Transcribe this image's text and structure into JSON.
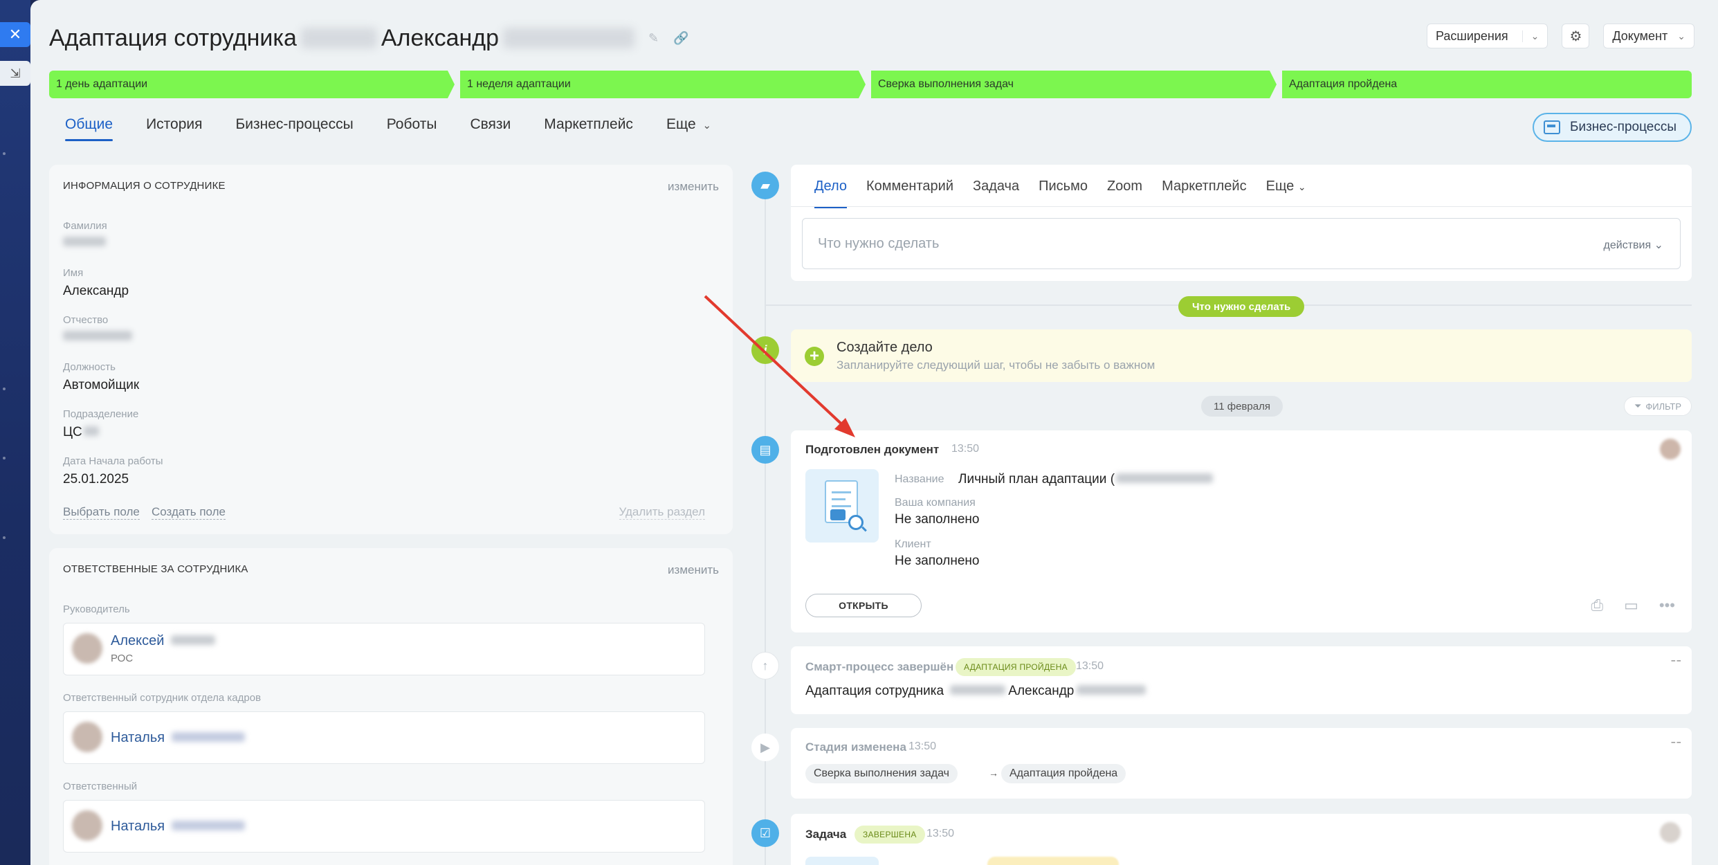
{
  "window": {
    "title_prefix": "Адаптация сотрудника",
    "title_name": "Александр",
    "title_icons": "✎ 🔗"
  },
  "sidebar": {
    "close_icon": "✕",
    "minimize_icon": "⇲"
  },
  "top_actions": {
    "extensions_label": "Расширения",
    "document_label": "Документ",
    "chevron": "⌄",
    "gear": "⚙"
  },
  "stages": [
    {
      "label": "1 день адаптации"
    },
    {
      "label": "1 неделя адаптации"
    },
    {
      "label": "Сверка выполнения задач"
    },
    {
      "label": "Адаптация пройдена"
    }
  ],
  "colors": {
    "stage_green": "#7cf64f",
    "accent_blue": "#1c60c6",
    "timeline_blue": "#4fb0e8",
    "timeline_green": "#9ccd33"
  },
  "tabs": [
    {
      "label": "Общие"
    },
    {
      "label": "История"
    },
    {
      "label": "Бизнес-процессы"
    },
    {
      "label": "Роботы"
    },
    {
      "label": "Связи"
    },
    {
      "label": "Маркетплейс"
    },
    {
      "label": "Еще"
    }
  ],
  "bp_button": {
    "label": "Бизнес-процессы"
  },
  "employee_card": {
    "header": "Информация о сотруднике",
    "edit": "изменить",
    "fields": [
      {
        "label": "Фамилия",
        "value": ""
      },
      {
        "label": "Имя",
        "value": "Александр"
      },
      {
        "label": "Отчество",
        "value": ""
      },
      {
        "label": "Должность",
        "value": "Автомойщик"
      },
      {
        "label": "Подразделение",
        "value": "ЦС"
      },
      {
        "label": "Дата Начала работы",
        "value": "25.01.2025"
      }
    ],
    "select_field": "Выбрать поле",
    "create_field": "Создать поле",
    "delete_section": "Удалить раздел"
  },
  "responsible_card": {
    "header": "Ответственные за сотрудника",
    "edit": "изменить",
    "groups": [
      {
        "label": "Руководитель",
        "name": "Алексей",
        "sub": "РОС"
      },
      {
        "label": "Ответственный сотрудник отдела кадров",
        "name": "Наталья",
        "sub": ""
      },
      {
        "label": "Ответственный",
        "name": "Наталья",
        "sub": ""
      }
    ]
  },
  "composer": {
    "tabs": [
      "Дело",
      "Комментарий",
      "Задача",
      "Письмо",
      "Zoom",
      "Маркетплейс",
      "Еще"
    ],
    "placeholder": "Что нужно сделать",
    "actions": "действия"
  },
  "timeline": {
    "todo_pill": "Что нужно сделать",
    "todo_title": "Создайте дело",
    "todo_sub": "Запланируйте следующий шаг, чтобы не забыть о важном",
    "date_pill": "11 февраля",
    "filter": "ФИЛЬТР",
    "doc_event": {
      "title": "Подготовлен документ",
      "time": "13:50",
      "name_label": "Название",
      "name_value": "Личный план адаптации (",
      "company_label": "Ваша компания",
      "company_value": "Не заполнено",
      "client_label": "Клиент",
      "client_value": "Не заполнено",
      "open_button": "ОТКРЫТЬ"
    },
    "smart_event": {
      "title": "Смарт-процесс завершён",
      "badge": "АДАПТАЦИЯ ПРОЙДЕНА",
      "time": "13:50",
      "text_prefix": "Адаптация сотрудника",
      "text_name": "Александр"
    },
    "stage_event": {
      "title": "Стадия изменена",
      "time": "13:50",
      "from": "Сверка выполнения задач",
      "arrow": "→",
      "to": "Адаптация пройдена"
    },
    "task_event": {
      "title": "Задача",
      "badge": "ЗАВЕРШЕНА",
      "time": "13:50"
    }
  }
}
